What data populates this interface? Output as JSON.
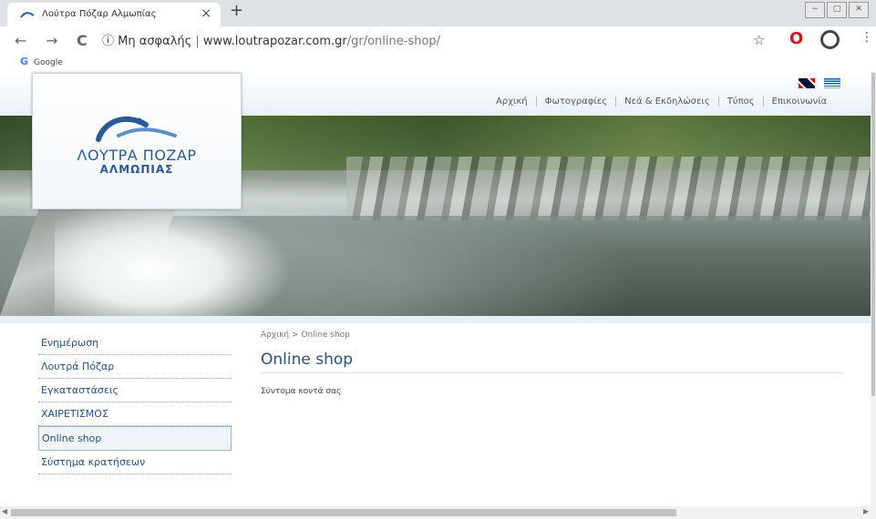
{
  "browser": {
    "tab_title": "Λούτρα Πόζαρ Αλμωπίας",
    "tab_close": "×",
    "new_tab": "+",
    "back": "←",
    "forward": "→",
    "reload": "C",
    "security_text": "Μη ασφαλής",
    "url_host": "www.loutrapozar.com.gr",
    "url_path": "/gr/online-shop/",
    "bookmark": "Google",
    "window_buttons": [
      "−",
      "▢",
      "✕"
    ]
  },
  "site": {
    "logo_line1": "ΛΟΥΤΡΑ ΠΟΖΑΡ",
    "logo_line2": "ΑΛΜΩΠΙΑΣ",
    "menu": [
      "Αρχική",
      "Φωτογραφίες",
      "Νεά & Εκδηλώσεις",
      "Τύπος",
      "Επικοινωνία"
    ]
  },
  "sidebar": {
    "items": [
      {
        "label": "Ενημέρωση"
      },
      {
        "label": "Λουτρά Πόζαρ"
      },
      {
        "label": "Εγκαταστάσεις"
      },
      {
        "label": "ΧΑΙΡΕΤΙΣΜΟΣ"
      },
      {
        "label": "Online shop",
        "active": true
      },
      {
        "label": "Σύστημα κρατήσεων"
      }
    ]
  },
  "main": {
    "breadcrumb": "Αρχική  >  Online shop",
    "title": "Online shop",
    "body": "Σύντομα κοντά σας"
  },
  "colors": {
    "accent": "#2a4f7a",
    "logo": "#2a5a9a"
  }
}
